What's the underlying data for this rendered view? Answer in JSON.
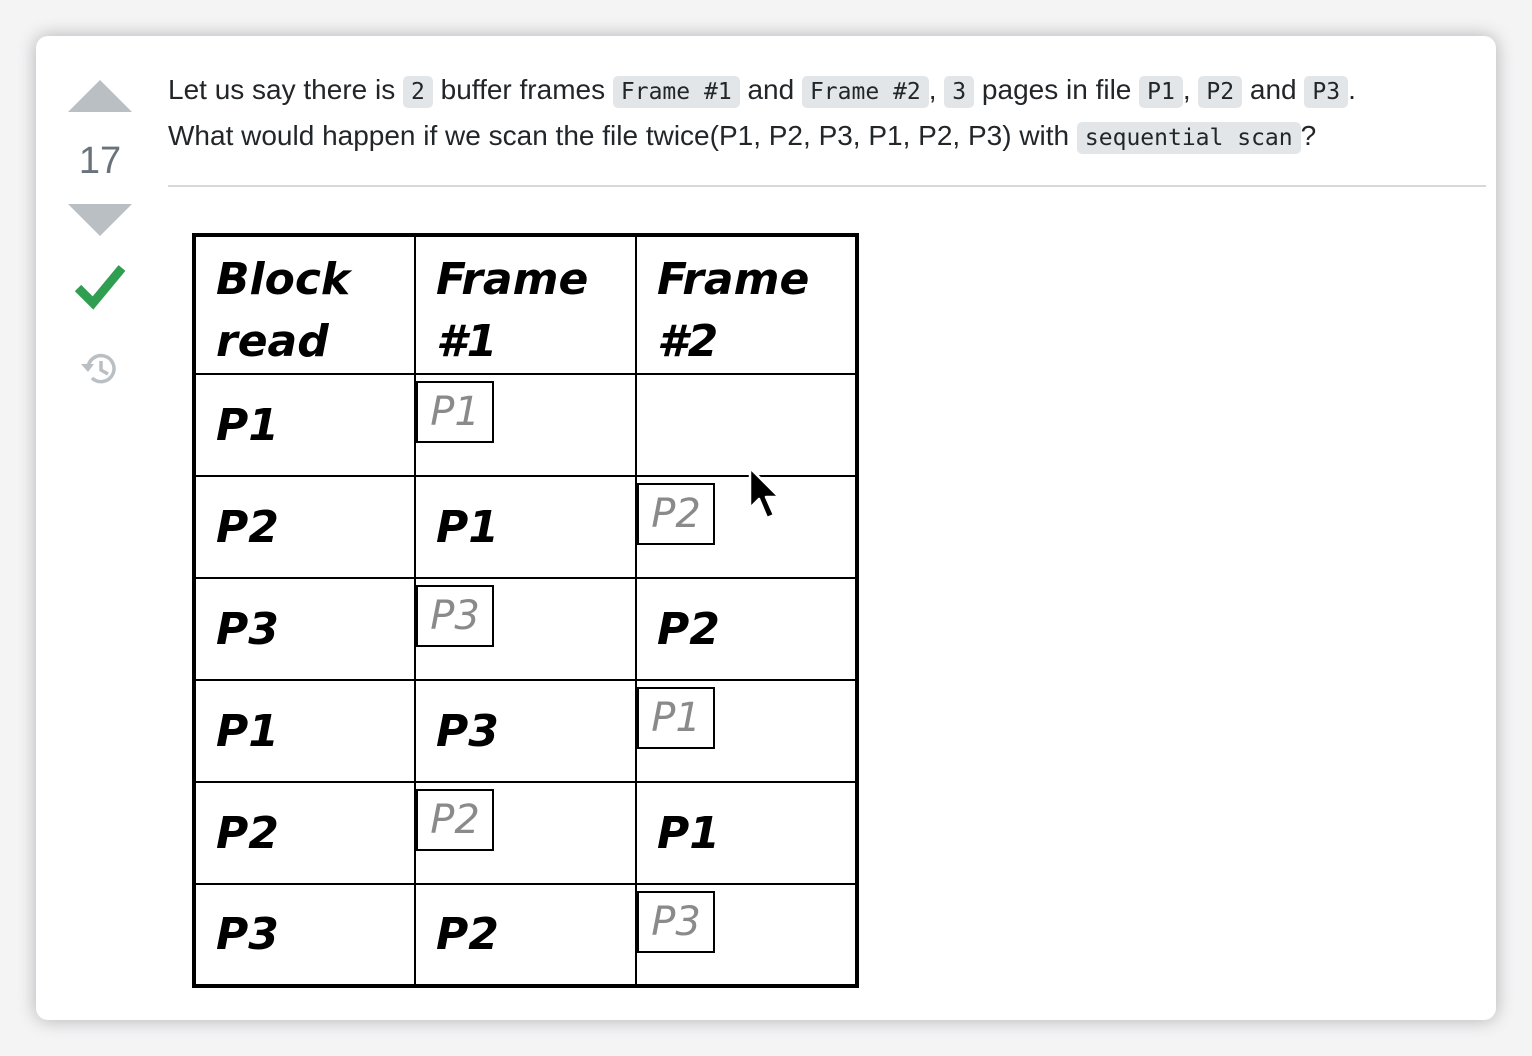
{
  "vote": {
    "score": "17"
  },
  "question": {
    "line1": [
      {
        "t": "text",
        "v": "Let us say there is "
      },
      {
        "t": "code",
        "v": "2"
      },
      {
        "t": "text",
        "v": " buffer frames "
      },
      {
        "t": "code",
        "v": "Frame #1"
      },
      {
        "t": "text",
        "v": " and "
      },
      {
        "t": "code",
        "v": "Frame #2"
      },
      {
        "t": "text",
        "v": ", "
      },
      {
        "t": "code",
        "v": "3"
      },
      {
        "t": "text",
        "v": " pages in file "
      },
      {
        "t": "code",
        "v": "P1"
      },
      {
        "t": "text",
        "v": ", "
      },
      {
        "t": "code",
        "v": "P2"
      },
      {
        "t": "text",
        "v": " and "
      },
      {
        "t": "code",
        "v": "P3"
      },
      {
        "t": "text",
        "v": "."
      }
    ],
    "line2": [
      {
        "t": "text",
        "v": "What would happen if we scan the file twice(P1, P2, P3, P1, P2, P3) with "
      },
      {
        "t": "code",
        "v": "sequential scan"
      },
      {
        "t": "text",
        "v": "?"
      }
    ]
  },
  "table": {
    "headers": [
      [
        "Block",
        "read"
      ],
      [
        "Frame",
        "#1"
      ],
      [
        "Frame",
        "#2"
      ]
    ],
    "rows": [
      {
        "block": "P1",
        "frame1": "P1",
        "frame1_boxed": true,
        "frame2": "",
        "frame2_boxed": false
      },
      {
        "block": "P2",
        "frame1": "P1",
        "frame1_boxed": false,
        "frame2": "P2",
        "frame2_boxed": true
      },
      {
        "block": "P3",
        "frame1": "P3",
        "frame1_boxed": true,
        "frame2": "P2",
        "frame2_boxed": false
      },
      {
        "block": "P1",
        "frame1": "P3",
        "frame1_boxed": false,
        "frame2": "P1",
        "frame2_boxed": true
      },
      {
        "block": "P2",
        "frame1": "P2",
        "frame1_boxed": true,
        "frame2": "P1",
        "frame2_boxed": false
      },
      {
        "block": "P3",
        "frame1": "P2",
        "frame1_boxed": false,
        "frame2": "P3",
        "frame2_boxed": true
      }
    ]
  },
  "colors": {
    "accepted": "#2f9e50",
    "arrow": "#babfc4",
    "score": "#6a737c",
    "code_bg": "#e3e6e8"
  }
}
